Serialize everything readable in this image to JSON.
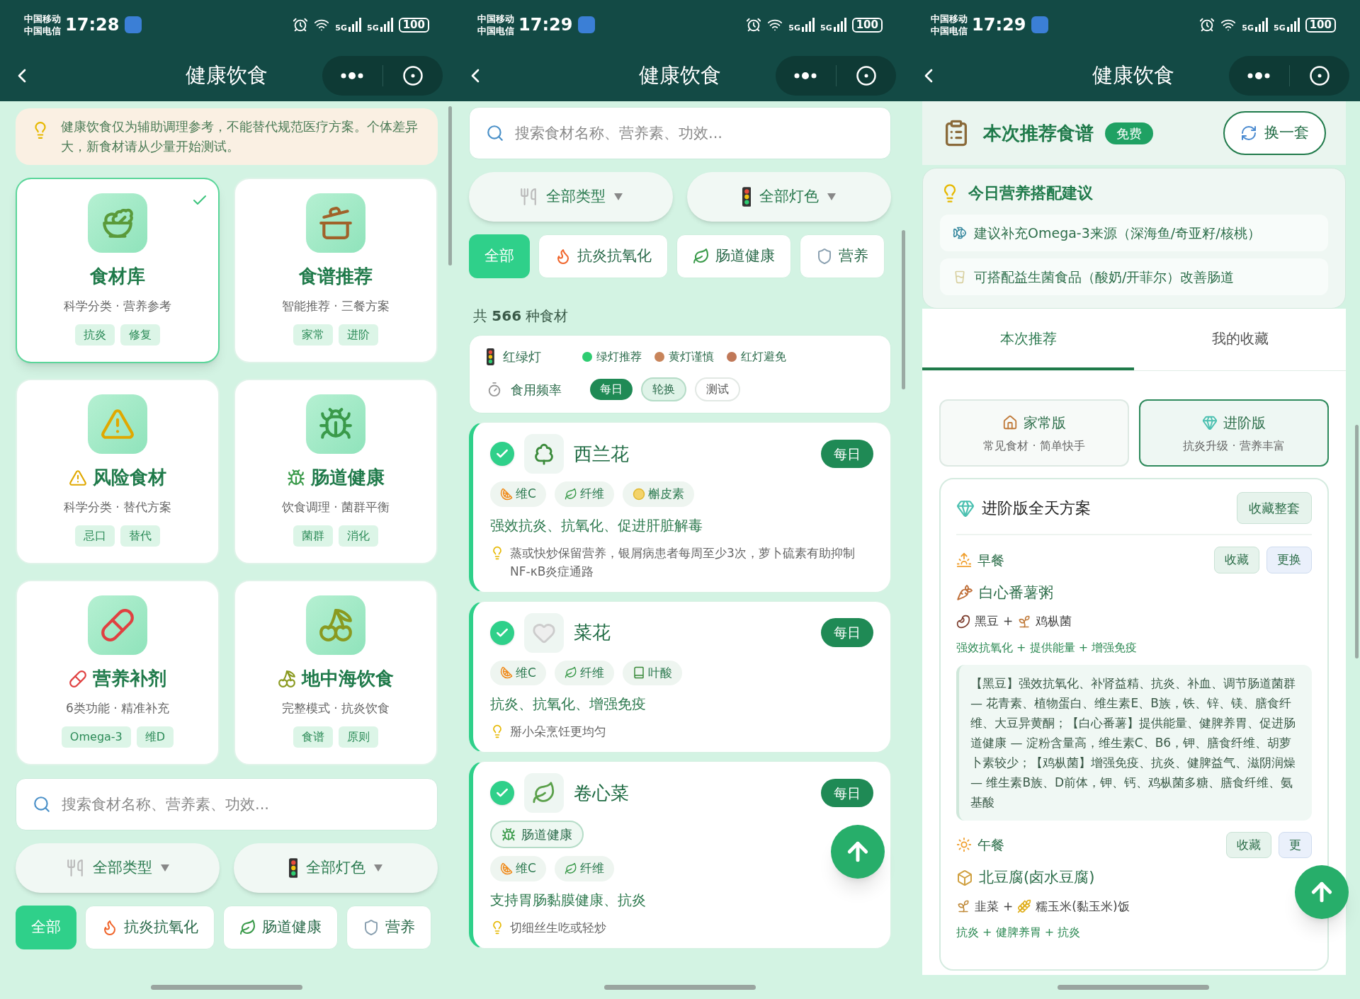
{
  "screens": [
    {
      "kind": "home",
      "status": {
        "carriers": [
          "中国移动",
          "中国电信"
        ],
        "time": "17:28",
        "network": [
          "5G",
          "5G"
        ],
        "battery": "100"
      },
      "title": "健康饮食",
      "notice": "健康饮食仅为辅助调理参考，不能替代规范医疗方案。个体差异大，新食材请从少量开始测试。",
      "modules": [
        {
          "title": "食材库",
          "subtitle": "科学分类 · 营养参考",
          "tags": [
            "抗炎",
            "修复"
          ],
          "selected": true,
          "title_icon": false
        },
        {
          "title": "食谱推荐",
          "subtitle": "智能推荐 · 三餐方案",
          "tags": [
            "家常",
            "进阶"
          ],
          "selected": false,
          "title_icon": false
        },
        {
          "title": "风险食材",
          "subtitle": "科学分类 · 替代方案",
          "tags": [
            "忌口",
            "替代"
          ],
          "selected": false,
          "title_icon": true
        },
        {
          "title": "肠道健康",
          "subtitle": "饮食调理 · 菌群平衡",
          "tags": [
            "菌群",
            "消化"
          ],
          "selected": false,
          "title_icon": true
        },
        {
          "title": "营养补剂",
          "subtitle": "6类功能 · 精准补充",
          "tags": [
            "Omega-3",
            "维D"
          ],
          "selected": false,
          "title_icon": true
        },
        {
          "title": "地中海饮食",
          "subtitle": "完整模式 · 抗炎饮食",
          "tags": [
            "食谱",
            "原则"
          ],
          "selected": false,
          "title_icon": true
        }
      ],
      "search": {
        "placeholder": "搜索食材名称、营养素、功效..."
      },
      "dropdowns": [
        {
          "label": "全部类型",
          "kind": "type"
        },
        {
          "label": "全部灯色",
          "kind": "light"
        }
      ],
      "filters": [
        {
          "label": "全部",
          "kind": "all",
          "selected": true
        },
        {
          "label": "抗炎抗氧化",
          "kind": "fire",
          "selected": false
        },
        {
          "label": "肠道健康",
          "kind": "leaf",
          "selected": false
        },
        {
          "label": "营养",
          "kind": "shield",
          "selected": false
        }
      ]
    },
    {
      "kind": "library",
      "status": {
        "carriers": [
          "中国移动",
          "中国电信"
        ],
        "time": "17:29",
        "network": [
          "5G",
          "5G"
        ],
        "battery": "100"
      },
      "title": "健康饮食",
      "search": {
        "placeholder": "搜索食材名称、营养素、功效..."
      },
      "dropdowns": [
        {
          "label": "全部类型",
          "kind": "type"
        },
        {
          "label": "全部灯色",
          "kind": "light"
        }
      ],
      "filters": [
        {
          "label": "全部",
          "kind": "all",
          "selected": true
        },
        {
          "label": "抗炎抗氧化",
          "kind": "fire",
          "selected": false
        },
        {
          "label": "肠道健康",
          "kind": "leaf",
          "selected": false
        },
        {
          "label": "营养",
          "kind": "shield",
          "selected": false
        }
      ],
      "count": "共 **566** 种食材",
      "legend": {
        "label": "红绿灯",
        "items": [
          {
            "label": "绿灯推荐",
            "color": "#2ecc71"
          },
          {
            "label": "黄灯谨慎",
            "color": "#c8845a"
          },
          {
            "label": "红灯避免",
            "color": "#c07858"
          }
        ]
      },
      "frequency": {
        "label": "食用频率",
        "items": [
          {
            "label": "每日",
            "kind": "solid"
          },
          {
            "label": "轮换",
            "kind": "soft"
          },
          {
            "label": "测试",
            "kind": "outline"
          }
        ]
      },
      "foods": [
        {
          "name": "西兰花",
          "checked": true,
          "badge": "每日",
          "nutrients": [
            {
              "label": "维C",
              "kind": "fruit"
            },
            {
              "label": "纤维",
              "kind": "fiber"
            },
            {
              "label": "槲皮素",
              "kind": "flavonoid"
            }
          ],
          "benefit": "强效抗炎、抗氧化、促进肝脏解毒",
          "tip": "蒸或快炒保留营养，银屑病患者每周至少3次，萝卜硫素有助抑制NF-κB炎症通路"
        },
        {
          "name": "菜花",
          "checked": true,
          "badge": "每日",
          "nutrients": [
            {
              "label": "维C",
              "kind": "fruit"
            },
            {
              "label": "纤维",
              "kind": "fiber"
            },
            {
              "label": "叶酸",
              "kind": "folate"
            }
          ],
          "benefit": "抗炎、抗氧化、增强免疫",
          "tip": "掰小朵烹饪更均匀"
        },
        {
          "name": "卷心菜",
          "checked": true,
          "badge": "每日",
          "category": "肠道健康",
          "nutrients": [
            {
              "label": "维C",
              "kind": "fruit"
            },
            {
              "label": "纤维",
              "kind": "fiber"
            }
          ],
          "benefit": "支持胃肠黏膜健康、抗炎",
          "tip": "切细丝生吃或轻炒"
        }
      ]
    },
    {
      "kind": "recipes",
      "status": {
        "carriers": [
          "中国移动",
          "中国电信"
        ],
        "time": "17:29",
        "network": [
          "5G",
          "5G"
        ],
        "battery": "100"
      },
      "title": "健康饮食",
      "header": {
        "title": "本次推荐食谱",
        "badge": "免费",
        "button": "换一套"
      },
      "advice": {
        "title": "今日营养搭配建议",
        "items": [
          {
            "text": "建议补充Omega-3来源（深海鱼/奇亚籽/核桃）",
            "kind": "fish"
          },
          {
            "text": "可搭配益生菌食品（酸奶/开菲尔）改善肠道",
            "kind": "drink"
          }
        ]
      },
      "tabs": [
        {
          "label": "本次推荐",
          "selected": true
        },
        {
          "label": "我的收藏",
          "selected": false
        }
      ],
      "versions": [
        {
          "title": "家常版",
          "subtitle": "常见食材 · 简单快手",
          "kind": "home",
          "selected": false
        },
        {
          "title": "进阶版",
          "subtitle": "抗炎升级 · 营养丰富",
          "kind": "gem",
          "selected": true
        }
      ],
      "plan": {
        "title": "进阶版全天方案",
        "button": "收藏整套",
        "meals": [
          {
            "name": "早餐",
            "kind": "sunrise",
            "buttons": [
              "收藏",
              "更换"
            ],
            "dish": "白心番薯粥",
            "ingredients": [
              "黑豆",
              "鸡枞菌"
            ],
            "joiner": "+",
            "effects": "强效抗氧化 + 提供能量 + 增强免疫",
            "detail": "【黑豆】强效抗氧化、补肾益精、抗炎、补血、调节肠道菌群 — 花青素、植物蛋白、维生素E、B族，铁、锌、镁、膳食纤维、大豆异黄酮；【白心番薯】提供能量、健脾养胃、促进肠道健康 — 淀粉含量高，维生素C、B6，钾、膳食纤维、胡萝卜素较少；【鸡枞菌】增强免疫、抗炎、健脾益气、滋阴润燥 — 维生素B族、D前体，钾、钙、鸡枞菌多糖、膳食纤维、氨基酸"
          },
          {
            "name": "午餐",
            "kind": "sun",
            "buttons": [
              "收藏",
              "更"
            ],
            "dish": "北豆腐(卤水豆腐)",
            "ingredients": [
              "韭菜",
              "糯玉米(黏玉米)饭"
            ],
            "joiner": "+",
            "effects": "抗炎 + 健脾养胃 + 抗炎"
          }
        ]
      }
    }
  ]
}
